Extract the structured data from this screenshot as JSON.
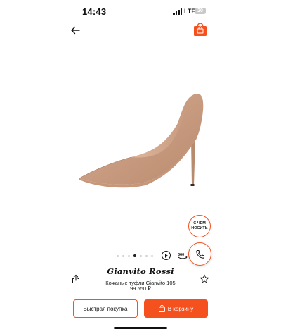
{
  "status_bar": {
    "time": "14:43",
    "network": "LTE",
    "battery": "20"
  },
  "nav": {
    "back_icon": "arrow-left-icon",
    "cart_icon": "shopping-bag-icon"
  },
  "gallery": {
    "image_alt": "Кожаные туфли Gianvito 105",
    "dot_count": 7,
    "active_dot": 3,
    "play_icon": "play-icon",
    "view360_icon": "view-360-icon"
  },
  "floating": {
    "what_to_wear_label": "С ЧЕМ\nНОСИТЬ",
    "call_icon": "phone-icon"
  },
  "product": {
    "brand": "Gianvito Rossi",
    "name": "Кожаные туфли Gianvito 105",
    "price": "99 550 ₽",
    "share_icon": "share-icon",
    "favorite_icon": "star-icon"
  },
  "actions": {
    "quick_buy_label": "Быстрая покупка",
    "add_to_cart_label": "В корзину"
  },
  "colors": {
    "accent": "#f4511e",
    "shoe": "#c99a7e"
  }
}
